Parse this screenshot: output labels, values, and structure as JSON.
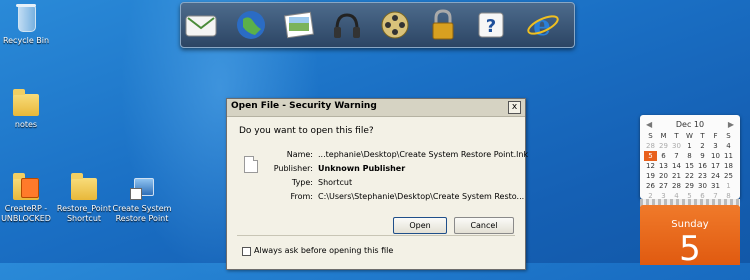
{
  "desktop": {
    "icons": [
      {
        "label": "Recycle Bin"
      },
      {
        "label": "notes"
      },
      {
        "label": "CreateRP - UNBLOCKED"
      },
      {
        "label": "Restore_Point Shortcut"
      },
      {
        "label": "Create System Restore Point"
      }
    ]
  },
  "dock": {
    "items": [
      "mail-icon",
      "globe-icon",
      "photos-icon",
      "headphones-icon",
      "film-reel-icon",
      "padlock-icon",
      "help-icon",
      "internet-explorer-icon"
    ]
  },
  "dialog": {
    "title": "Open File - Security Warning",
    "close_label": "x",
    "question": "Do you want to open this file?",
    "fields": [
      {
        "label": "Name:",
        "value": "...tephanie\\Desktop\\Create System Restore Point.lnk"
      },
      {
        "label": "Publisher:",
        "value": "Unknown Publisher"
      },
      {
        "label": "Type:",
        "value": "Shortcut"
      },
      {
        "label": "From:",
        "value": "C:\\Users\\Stephanie\\Desktop\\Create System Resto..."
      }
    ],
    "open_label": "Open",
    "cancel_label": "Cancel",
    "always_ask_label": "Always ask before opening this file"
  },
  "calendar": {
    "month_label": "Dec 10",
    "prev": "◀",
    "next": "▶",
    "day_name": "Sunday",
    "day_number": "5",
    "accent_color": "#e8601c"
  }
}
